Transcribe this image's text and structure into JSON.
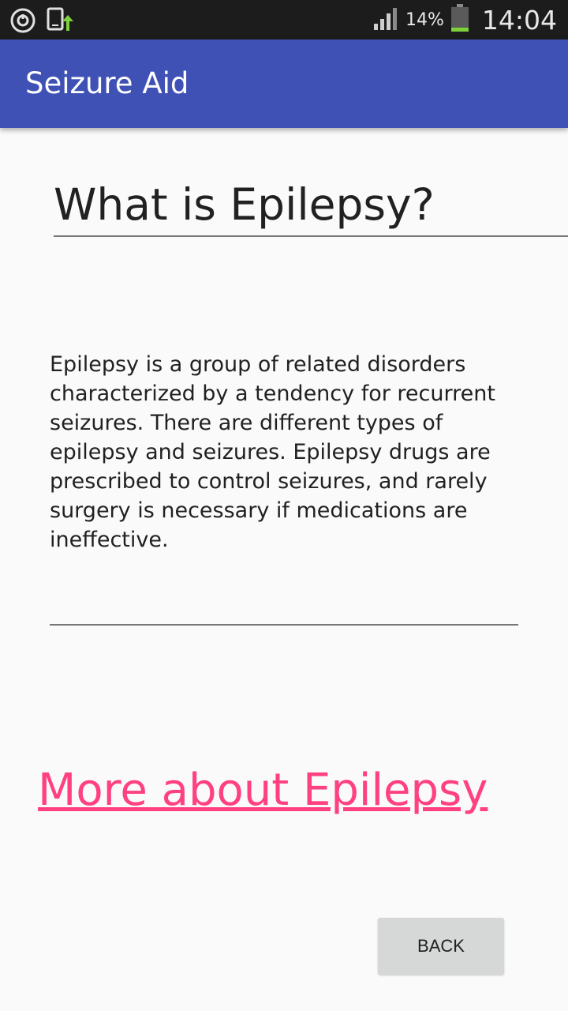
{
  "status_bar": {
    "icons_left": [
      "sync-icon",
      "device-upload-icon"
    ],
    "signal_icon": "signal-icon",
    "battery_percent": "14%",
    "battery_icon": "battery-icon",
    "time": "14:04"
  },
  "app_bar": {
    "title": "Seizure Aid",
    "color": "#3f51b5"
  },
  "content": {
    "heading": "What is Epilepsy?",
    "body": "Epilepsy is a group of related disorders characterized by a tendency for recurrent seizures. There are different types of epilepsy and seizures. Epilepsy drugs are prescribed to control seizures, and rarely surgery is necessary if medications are ineffective.",
    "more_link": "More about Epilepsy",
    "link_color": "#ff4081"
  },
  "actions": {
    "back_label": "BACK"
  }
}
